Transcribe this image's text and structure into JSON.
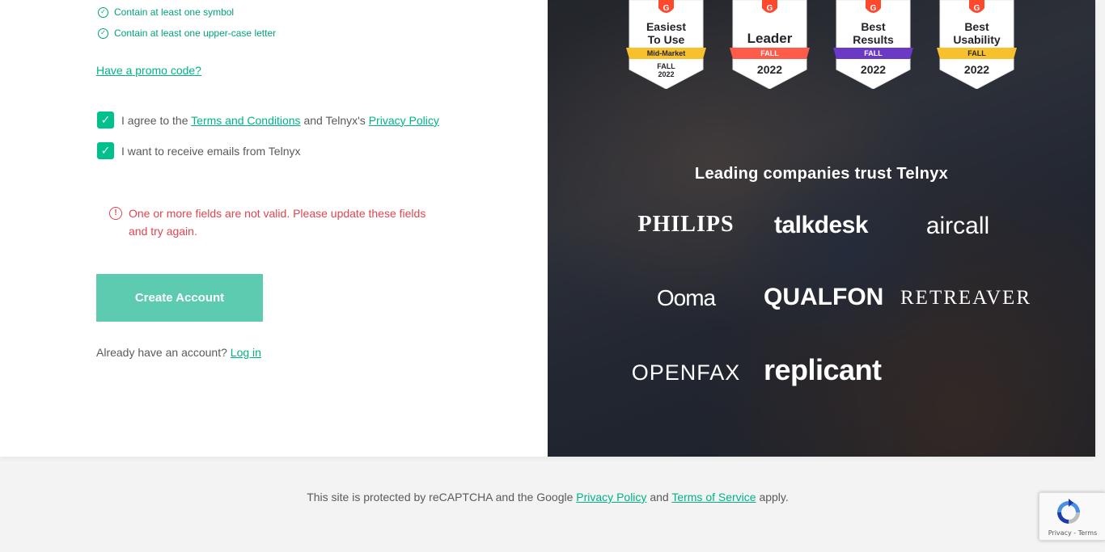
{
  "requirements": [
    {
      "label": "Contain at least one symbol"
    },
    {
      "label": "Contain at least one upper-case letter"
    }
  ],
  "promo_link": "Have a promo code?",
  "agree_terms": {
    "prefix": "I agree to the",
    "terms_link": "Terms and Conditions",
    "middle": "and Telnyx's",
    "privacy_link": "Privacy Policy",
    "checked": true
  },
  "email_optin": {
    "label": "I want to receive emails from Telnyx",
    "checked": true
  },
  "error_message": "One or more fields are not valid. Please update these fields and try again.",
  "create_button": "Create Account",
  "login": {
    "prompt": "Already have an account?",
    "link": "Log in"
  },
  "badges": [
    {
      "line1": "Easiest",
      "line2": "To Use",
      "ribbon": "Mid-Market",
      "season": "FALL",
      "year": "2022",
      "ribbon_color": "#f7c12d"
    },
    {
      "line1": "Leader",
      "line2": "",
      "ribbon": "FALL",
      "season": "",
      "year": "2022",
      "ribbon_color": "#ff5b4b"
    },
    {
      "line1": "Best",
      "line2": "Results",
      "ribbon": "FALL",
      "season": "",
      "year": "2022",
      "ribbon_color": "#6a39c5"
    },
    {
      "line1": "Best",
      "line2": "Usability",
      "ribbon": "FALL",
      "season": "",
      "year": "2022",
      "ribbon_color": "#f7c12d"
    }
  ],
  "trust_heading": "Leading companies trust Telnyx",
  "logos": [
    "PHILIPS",
    "talkdesk",
    "aircall",
    "Ooma",
    "QUALFON",
    "RETREAVER",
    "OPENFAX",
    "replicant"
  ],
  "footer": {
    "prefix": "This site is protected by reCAPTCHA and the Google",
    "privacy": "Privacy Policy",
    "and": "and",
    "terms": "Terms of Service",
    "suffix": "apply."
  },
  "recaptcha": {
    "privacy": "Privacy",
    "separator": " - ",
    "terms": "Terms"
  },
  "colors": {
    "accent": "#00b386",
    "error": "#e0454f",
    "button": "#5dcbb0",
    "checkbox": "#00c08b"
  }
}
